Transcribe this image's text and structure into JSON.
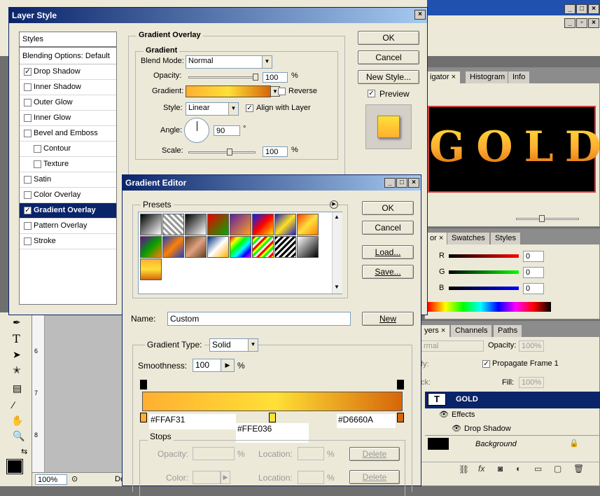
{
  "layer_style": {
    "title": "Layer Style",
    "styles_header": "Styles",
    "blending": "Blending Options: Default",
    "items": [
      {
        "label": "Drop Shadow",
        "checked": true
      },
      {
        "label": "Inner Shadow",
        "checked": false
      },
      {
        "label": "Outer Glow",
        "checked": false
      },
      {
        "label": "Inner Glow",
        "checked": false
      },
      {
        "label": "Bevel and Emboss",
        "checked": false
      },
      {
        "label": "Contour",
        "checked": false
      },
      {
        "label": "Texture",
        "checked": false
      },
      {
        "label": "Satin",
        "checked": false
      },
      {
        "label": "Color Overlay",
        "checked": false
      },
      {
        "label": "Gradient Overlay",
        "checked": true
      },
      {
        "label": "Pattern Overlay",
        "checked": false
      },
      {
        "label": "Stroke",
        "checked": false
      }
    ],
    "group_title": "Gradient Overlay",
    "subgroup_title": "Gradient",
    "blend_mode_label": "Blend Mode:",
    "blend_mode_value": "Normal",
    "opacity_label": "Opacity:",
    "opacity_value": "100",
    "percent": "%",
    "gradient_label": "Gradient:",
    "reverse_label": "Reverse",
    "style_label": "Style:",
    "style_value": "Linear",
    "align_label": "Align with Layer",
    "angle_label": "Angle:",
    "angle_value": "90",
    "degree": "°",
    "scale_label": "Scale:",
    "scale_value": "100",
    "ok": "OK",
    "cancel": "Cancel",
    "new_style": "New Style...",
    "preview": "Preview"
  },
  "gradient_editor": {
    "title": "Gradient Editor",
    "presets_label": "Presets",
    "ok": "OK",
    "cancel": "Cancel",
    "load": "Load...",
    "save": "Save...",
    "name_label": "Name:",
    "name_value": "Custom",
    "new": "New",
    "type_label": "Gradient Type:",
    "type_value": "Solid",
    "smoothness_label": "Smoothness:",
    "smoothness_value": "100",
    "percent": "%",
    "stop_left_hex": "#FFAF31",
    "stop_mid_hex": "#FFE036",
    "stop_right_hex": "#D6660A",
    "stops_label": "Stops",
    "opacity_label": "Opacity:",
    "location_label": "Location:",
    "color_label": "Color:",
    "delete": "Delete"
  },
  "navigator": {
    "tabs": [
      "igator",
      "Histogram",
      "Info"
    ],
    "canvas_text": "GOLD"
  },
  "color_panel": {
    "tabs": [
      "or",
      "Swatches",
      "Styles"
    ],
    "channels": [
      {
        "label": "R",
        "value": "0"
      },
      {
        "label": "G",
        "value": "0"
      },
      {
        "label": "B",
        "value": "0"
      }
    ]
  },
  "layers_panel": {
    "tabs": [
      "yers",
      "Channels",
      "Paths"
    ],
    "mode": "rmal",
    "opacity_label": "Opacity:",
    "opacity_value": "100%",
    "lock_label": "ck:",
    "unify_label": "fy:",
    "propagate_label": "Propagate Frame 1",
    "fill_label": "Fill:",
    "fill_value": "100%",
    "layers": [
      {
        "name": "GOLD"
      },
      {
        "name": "Effects"
      },
      {
        "name": "Drop Shadow"
      },
      {
        "name": "Background"
      }
    ]
  },
  "status": {
    "zoom": "100%",
    "doc": "Do"
  },
  "colors": {
    "gold_light": "#FFAF31",
    "gold_mid": "#FFE036",
    "gold_dark": "#D6660A",
    "selection": "#0a246a"
  }
}
